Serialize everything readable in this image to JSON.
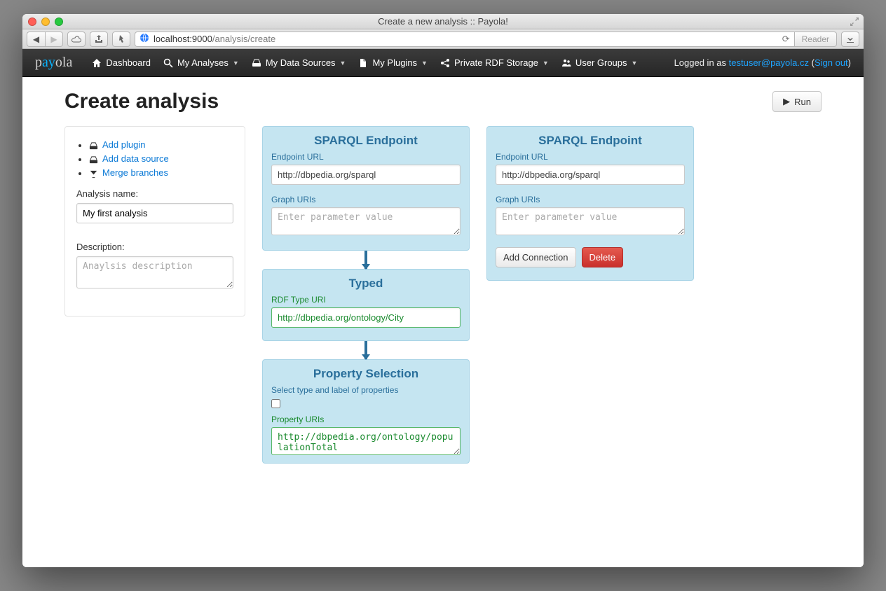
{
  "window": {
    "title": "Create a new analysis :: Payola!",
    "url_host": "localhost",
    "url_port": ":9000",
    "url_path": "/analysis/create",
    "reader": "Reader"
  },
  "navbar": {
    "brand_pre": "p",
    "brand_mid": "ay",
    "brand_post": "ola",
    "items": [
      {
        "label": "Dashboard",
        "dropdown": false,
        "icon": "home"
      },
      {
        "label": "My Analyses",
        "dropdown": true,
        "icon": "search"
      },
      {
        "label": "My Data Sources",
        "dropdown": true,
        "icon": "hdd"
      },
      {
        "label": "My Plugins",
        "dropdown": true,
        "icon": "file"
      },
      {
        "label": "Private RDF Storage",
        "dropdown": true,
        "icon": "share"
      },
      {
        "label": "User Groups",
        "dropdown": true,
        "icon": "users"
      }
    ],
    "right_prefix": "Logged in as ",
    "user": "testuser@payola.cz",
    "signout": "Sign out"
  },
  "page": {
    "heading": "Create analysis",
    "run": "Run"
  },
  "sidebar": {
    "actions": [
      {
        "label": "Add plugin",
        "icon": "hdd"
      },
      {
        "label": "Add data source",
        "icon": "hdd"
      },
      {
        "label": "Merge branches",
        "icon": "glass"
      }
    ],
    "name_label": "Analysis name:",
    "name_value": "My first analysis",
    "desc_label": "Description:",
    "desc_placeholder": "Anaylsis description"
  },
  "pipeline": [
    {
      "title": "SPARQL Endpoint",
      "fields": [
        {
          "label": "Endpoint URL",
          "type": "text",
          "value": "http://dbpedia.org/sparql"
        },
        {
          "label": "Graph URIs",
          "type": "textarea",
          "placeholder": "Enter parameter value"
        }
      ]
    },
    {
      "title": "Typed",
      "fields": [
        {
          "label": "RDF Type URI",
          "type": "text",
          "value": "http://dbpedia.org/ontology/City",
          "green": true
        }
      ]
    },
    {
      "title": "Property Selection",
      "subtitle": "Select type and label of properties",
      "checkbox": true,
      "fields": [
        {
          "label": "Property URIs",
          "type": "textarea",
          "value": "http://dbpedia.org/ontology/populationTotal",
          "green": true
        }
      ]
    }
  ],
  "right_card": {
    "title": "SPARQL Endpoint",
    "fields": [
      {
        "label": "Endpoint URL",
        "type": "text",
        "value": "http://dbpedia.org/sparql"
      },
      {
        "label": "Graph URIs",
        "type": "textarea",
        "placeholder": "Enter parameter value"
      }
    ],
    "add_connection": "Add Connection",
    "delete": "Delete"
  }
}
